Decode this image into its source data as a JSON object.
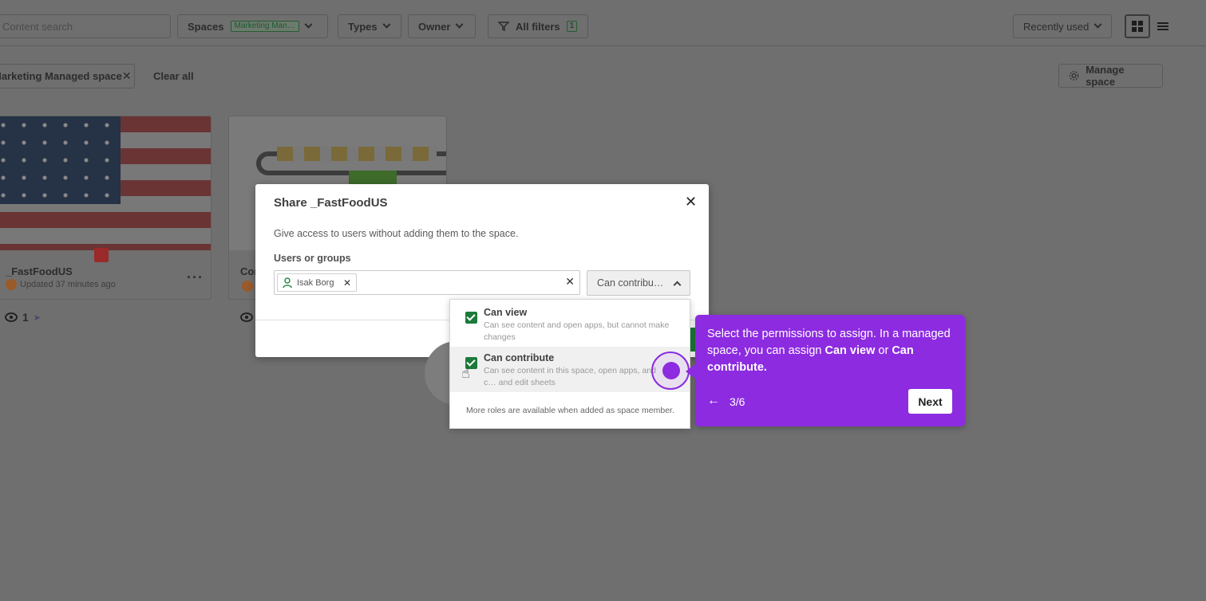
{
  "toolbar": {
    "search_placeholder": "Content search",
    "spaces_label": "Spaces",
    "spaces_tag": "Marketing Man…",
    "types_label": "Types",
    "owner_label": "Owner",
    "all_filters_label": "All filters",
    "all_filters_count": "1",
    "sort_label": "Recently used"
  },
  "filterbar": {
    "chip_label": "Marketing Managed space",
    "clear_all": "Clear all",
    "manage_space": "Manage space"
  },
  "cards": [
    {
      "title": "_FastFoodUS",
      "subtitle": "Updated 37 minutes ago",
      "views": "1"
    },
    {
      "title": "Con"
    }
  ],
  "modal": {
    "title": "Share _FastFoodUS",
    "description": "Give access to users without adding them to the space.",
    "users_label": "Users or groups",
    "user_chip": "Isak Borg",
    "permission_value": "Can contribu…"
  },
  "dropdown": {
    "options": [
      {
        "title": "Can view",
        "desc": "Can see content and open apps, but cannot make changes"
      },
      {
        "title": "Can contribute",
        "desc": "Can see content in this space, open apps, and c… and edit sheets"
      }
    ],
    "footer": "More roles are available when added as space member."
  },
  "tour": {
    "text_part1": "Select the permissions to assign. In a managed space, you can assign ",
    "bold1": "Can view",
    "text_part2": " or ",
    "bold2": "Can contribute.",
    "step": "3/6",
    "next_label": "Next",
    "accent": "#8c2be0"
  },
  "colors": {
    "overlay": "#6f6f6f",
    "check_green": "#1c7a3a"
  }
}
